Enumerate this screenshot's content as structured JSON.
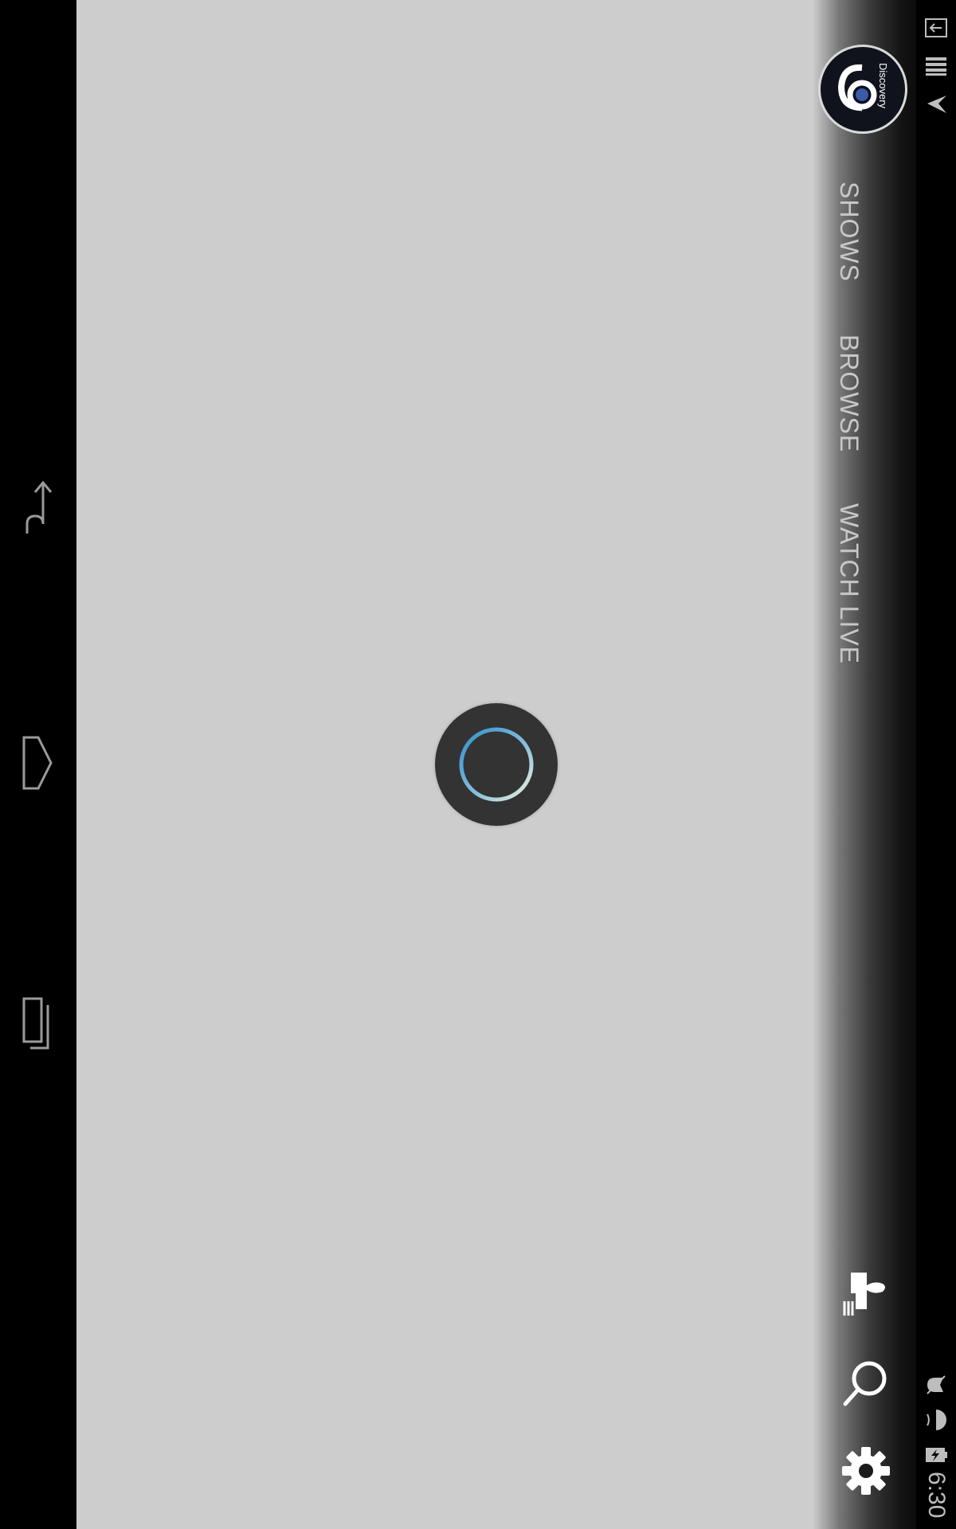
{
  "navigation_bar": {
    "back_icon": "back-arrow-icon",
    "home_icon": "home-icon",
    "recents_icon": "recent-apps-icon"
  },
  "app": {
    "logo_text": "Discovery",
    "tabs": [
      {
        "label": "SHOWS"
      },
      {
        "label": "BROWSE"
      },
      {
        "label": "WATCH LIVE"
      }
    ],
    "icons": {
      "cast": "cast-icon",
      "search": "search-icon",
      "settings": "gear-icon"
    }
  },
  "loading": {
    "spinner_icon": "loading-spinner-icon"
  },
  "status_bar": {
    "time": "6:30",
    "icons": [
      "download-icon",
      "storage-icon",
      "app-notification-icon",
      "mute-icon",
      "wifi-icon",
      "battery-charging-icon"
    ]
  },
  "colors": {
    "content_bg": "#cdcdcd",
    "spinner_bg": "#333333",
    "spinner_accent": "#2f8fc9",
    "tab_text": "#c8c8c8"
  }
}
